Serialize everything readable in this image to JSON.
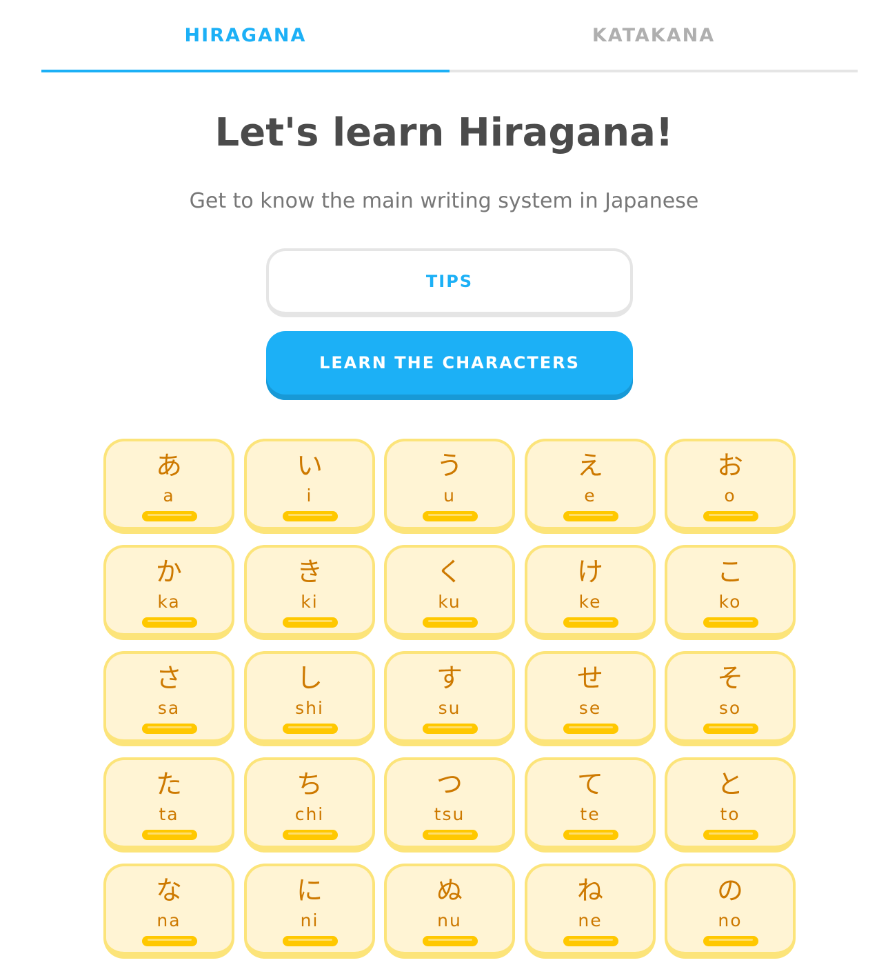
{
  "tabs": [
    {
      "label": "HIRAGANA",
      "active": true
    },
    {
      "label": "KATAKANA",
      "active": false
    }
  ],
  "header": {
    "title": "Let's learn Hiragana!",
    "subtitle": "Get to know the main writing system in Japanese"
  },
  "buttons": {
    "tips": "TIPS",
    "learn": "LEARN THE CHARACTERS"
  },
  "colors": {
    "accent": "#1cb0f6",
    "inactive_tab": "#afafaf",
    "card_bg": "#fff4d4",
    "card_border": "#fce47a",
    "card_text": "#cd7900",
    "progress": "#ffc800"
  },
  "characters": [
    {
      "kana": "あ",
      "romaji": "a",
      "progress": 1.0
    },
    {
      "kana": "い",
      "romaji": "i",
      "progress": 1.0
    },
    {
      "kana": "う",
      "romaji": "u",
      "progress": 1.0
    },
    {
      "kana": "え",
      "romaji": "e",
      "progress": 1.0
    },
    {
      "kana": "お",
      "romaji": "o",
      "progress": 1.0
    },
    {
      "kana": "か",
      "romaji": "ka",
      "progress": 1.0
    },
    {
      "kana": "き",
      "romaji": "ki",
      "progress": 1.0
    },
    {
      "kana": "く",
      "romaji": "ku",
      "progress": 1.0
    },
    {
      "kana": "け",
      "romaji": "ke",
      "progress": 1.0
    },
    {
      "kana": "こ",
      "romaji": "ko",
      "progress": 1.0
    },
    {
      "kana": "さ",
      "romaji": "sa",
      "progress": 1.0
    },
    {
      "kana": "し",
      "romaji": "shi",
      "progress": 1.0
    },
    {
      "kana": "す",
      "romaji": "su",
      "progress": 1.0
    },
    {
      "kana": "せ",
      "romaji": "se",
      "progress": 1.0
    },
    {
      "kana": "そ",
      "romaji": "so",
      "progress": 1.0
    },
    {
      "kana": "た",
      "romaji": "ta",
      "progress": 1.0
    },
    {
      "kana": "ち",
      "romaji": "chi",
      "progress": 1.0
    },
    {
      "kana": "つ",
      "romaji": "tsu",
      "progress": 1.0
    },
    {
      "kana": "て",
      "romaji": "te",
      "progress": 1.0
    },
    {
      "kana": "と",
      "romaji": "to",
      "progress": 1.0
    },
    {
      "kana": "な",
      "romaji": "na",
      "progress": 1.0
    },
    {
      "kana": "に",
      "romaji": "ni",
      "progress": 1.0
    },
    {
      "kana": "ぬ",
      "romaji": "nu",
      "progress": 1.0
    },
    {
      "kana": "ね",
      "romaji": "ne",
      "progress": 1.0
    },
    {
      "kana": "の",
      "romaji": "no",
      "progress": 1.0
    }
  ]
}
